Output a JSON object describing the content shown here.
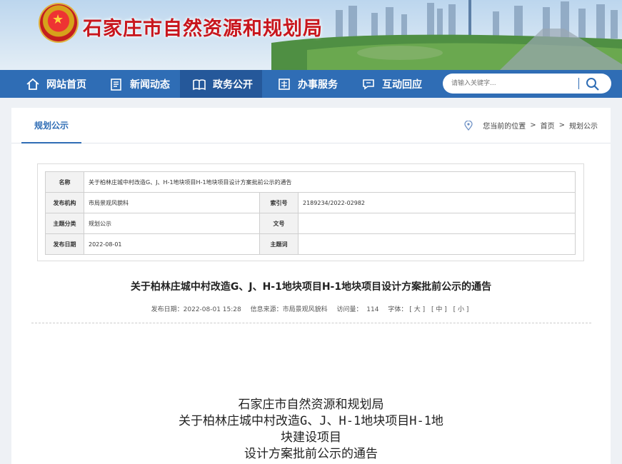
{
  "header": {
    "site_title": "石家庄市自然资源和规划局",
    "emblem_icon": "national-emblem-icon"
  },
  "nav": {
    "items": [
      {
        "label": "网站首页",
        "icon": "home-icon"
      },
      {
        "label": "新闻动态",
        "icon": "news-icon"
      },
      {
        "label": "政务公开",
        "icon": "open-government-icon",
        "active": true
      },
      {
        "label": "办事服务",
        "icon": "service-icon"
      },
      {
        "label": "互动回应",
        "icon": "interaction-icon"
      }
    ],
    "search_placeholder": "请输入关键字..."
  },
  "section": {
    "tab_label": "规划公示",
    "breadcrumb": {
      "location_label": "您当前的位置",
      "sep": ">",
      "home": "首页",
      "current": "规划公示"
    }
  },
  "meta": {
    "name_label": "名称",
    "name_value": "关于柏林庄城中村改造G、J、H-1地块项目H-1地块项目设计方案批前公示的通告",
    "org_label": "发布机构",
    "org_value": "市局景观风貌科",
    "index_label": "索引号",
    "index_value": "2189234/2022-02982",
    "category_label": "主题分类",
    "category_value": "规划公示",
    "docno_label": "文号",
    "docno_value": "",
    "date_label": "发布日期",
    "date_value": "2022-08-01",
    "keywords_label": "主题词",
    "keywords_value": ""
  },
  "article": {
    "title": "关于柏林庄城中村改造G、J、H-1地块项目H-1地块项目设计方案批前公示的通告",
    "publish": "发布日期：2022-08-01 15:28",
    "source": "信息来源：市局景观风貌科",
    "views_label": "访问量：",
    "views": "114",
    "font_label": "字体：",
    "font_large": "[ 大 ]",
    "font_medium": "[ 中 ]",
    "font_small": "[ 小 ]",
    "body_lines": [
      "石家庄市自然资源和规划局",
      "关于柏林庄城中村改造G、J、H-1地块项目H-1地",
      "块建设项目",
      "设计方案批前公示的通告"
    ]
  },
  "colors": {
    "nav_bg": "#2f6db5",
    "title_red": "#c8161d"
  }
}
